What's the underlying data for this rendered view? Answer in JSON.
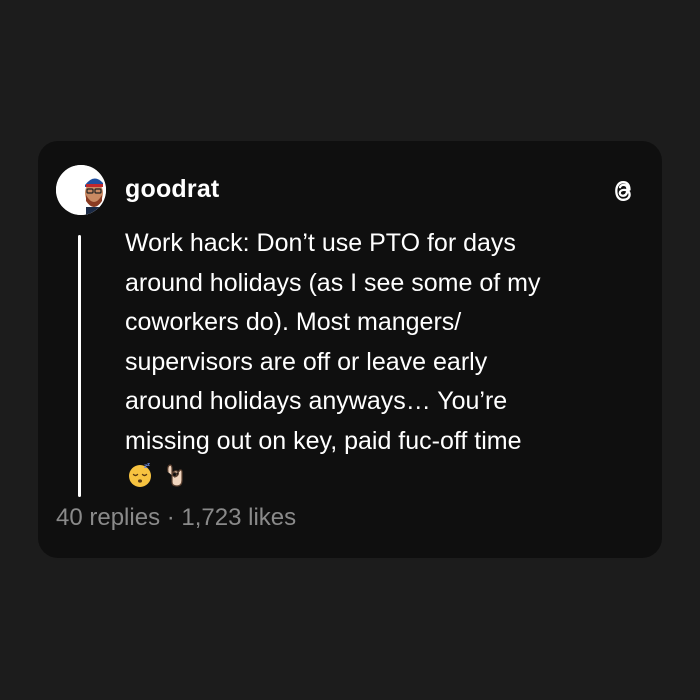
{
  "post": {
    "username": "goodrat",
    "text": "Work hack: Don’t use PTO for days\naround holidays (as I see some of my\ncoworkers do). Most mangers/\nsupervisors are off or leave early\naround holidays anyways… You’re\nmissing out on key, paid fuc-off time",
    "emojis": [
      "sleeping-face-icon",
      "ok-hand-icon"
    ],
    "replies_label": "40 replies",
    "separator": " · ",
    "likes_label": "1,723 likes"
  },
  "icons": {
    "platform": "threads-icon",
    "avatar": "avatar"
  },
  "colors": {
    "page_background": "#1c1c1c",
    "card_background": "#0f0f0f",
    "text": "#ffffff",
    "muted_text": "#8a8a8a"
  }
}
